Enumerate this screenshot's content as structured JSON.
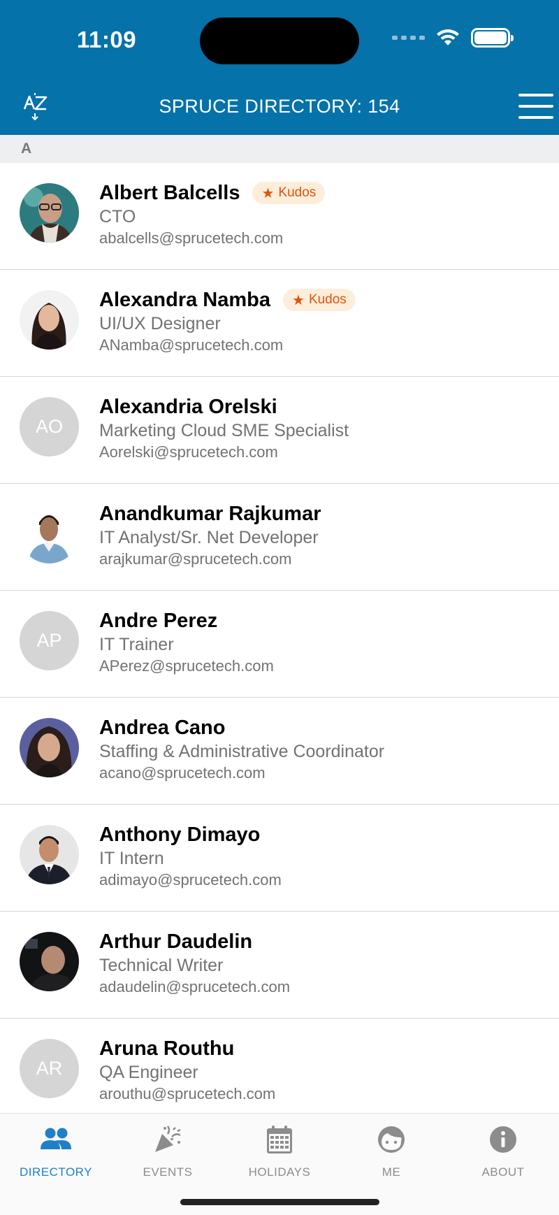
{
  "status_bar": {
    "time": "11:09"
  },
  "nav": {
    "sort_label": "A-Z",
    "title": "SPRUCE DIRECTORY: 154"
  },
  "section": {
    "letter": "A"
  },
  "colors": {
    "brand": "#0572a9",
    "kudos_bg": "#fdeedb",
    "kudos_text": "#e1520c",
    "active_tab": "#1f80c9"
  },
  "people": [
    {
      "name": "Albert Balcells",
      "title": "CTO",
      "email": "abalcells@sprucetech.com",
      "kudos": "Kudos",
      "avatar": "photo",
      "initials": ""
    },
    {
      "name": "Alexandra Namba",
      "title": "UI/UX Designer",
      "email": "ANamba@sprucetech.com",
      "kudos": "Kudos",
      "avatar": "photo",
      "initials": ""
    },
    {
      "name": "Alexandria Orelski",
      "title": "Marketing Cloud SME Specialist",
      "email": "Aorelski@sprucetech.com",
      "kudos": "",
      "avatar": "initials",
      "initials": "AO"
    },
    {
      "name": "Anandkumar Rajkumar",
      "title": "IT Analyst/Sr. Net Developer",
      "email": "arajkumar@sprucetech.com",
      "kudos": "",
      "avatar": "photo",
      "initials": ""
    },
    {
      "name": "Andre Perez",
      "title": "IT Trainer",
      "email": "APerez@sprucetech.com",
      "kudos": "",
      "avatar": "initials",
      "initials": "AP"
    },
    {
      "name": "Andrea Cano",
      "title": "Staffing & Administrative Coordinator",
      "email": "acano@sprucetech.com",
      "kudos": "",
      "avatar": "photo",
      "initials": ""
    },
    {
      "name": "Anthony Dimayo",
      "title": "IT Intern",
      "email": "adimayo@sprucetech.com",
      "kudos": "",
      "avatar": "photo",
      "initials": ""
    },
    {
      "name": "Arthur Daudelin",
      "title": "Technical Writer",
      "email": "adaudelin@sprucetech.com",
      "kudos": "",
      "avatar": "photo",
      "initials": ""
    },
    {
      "name": "Aruna Routhu",
      "title": "QA Engineer",
      "email": "arouthu@sprucetech.com",
      "kudos": "",
      "avatar": "initials",
      "initials": "AR"
    }
  ],
  "tabs": [
    {
      "label": "DIRECTORY",
      "icon": "people-icon",
      "active": true
    },
    {
      "label": "EVENTS",
      "icon": "party-popper-icon",
      "active": false
    },
    {
      "label": "HOLIDAYS",
      "icon": "calendar-icon",
      "active": false
    },
    {
      "label": "ME",
      "icon": "face-icon",
      "active": false
    },
    {
      "label": "ABOUT",
      "icon": "info-icon",
      "active": false
    }
  ]
}
